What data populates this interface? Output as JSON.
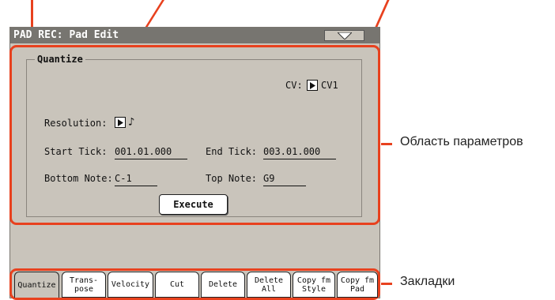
{
  "window": {
    "title": "PAD REC: Pad Edit"
  },
  "quantize_group": {
    "label": "Quantize",
    "cv_label": "CV:",
    "cv_value": "CV1",
    "resolution_label": "Resolution:",
    "resolution_value": "♪",
    "start_tick_label": "Start Tick:",
    "start_tick_value": "001.01.000",
    "end_tick_label": "End Tick:",
    "end_tick_value": "003.01.000",
    "bottom_note_label": "Bottom Note:",
    "bottom_note_value": "C-1",
    "top_note_label": "Top Note:",
    "top_note_value": "G9",
    "execute_label": "Execute"
  },
  "tabs": [
    {
      "label": "Quantize",
      "active": true
    },
    {
      "label": "Trans-\npose",
      "active": false
    },
    {
      "label": "Velocity",
      "active": false
    },
    {
      "label": "Cut",
      "active": false
    },
    {
      "label": "Delete",
      "active": false
    },
    {
      "label": "Delete\nAll",
      "active": false
    },
    {
      "label": "Copy fm\nStyle",
      "active": false
    },
    {
      "label": "Copy fm\nPad",
      "active": false
    }
  ],
  "callouts": {
    "parameters_area": "Область параметров",
    "tabs": "Закладки"
  },
  "colors": {
    "accent": "#e8411e",
    "screen_bg": "#c9c4bb",
    "titlebar_bg": "#777570"
  }
}
